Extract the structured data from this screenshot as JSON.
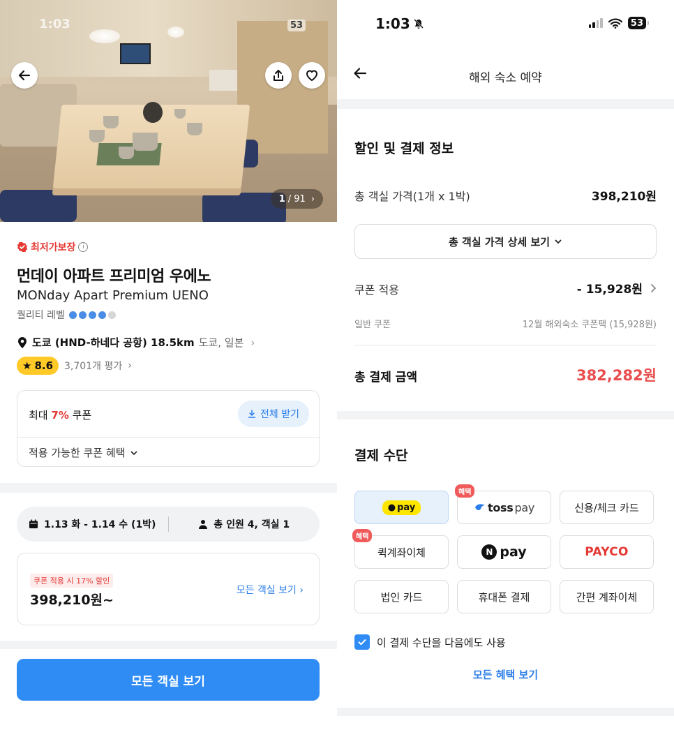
{
  "left": {
    "status_time": "1:03",
    "battery": "53",
    "photo_counter": {
      "current": "1",
      "total": "/ 91"
    },
    "lowest_price_badge": "최저가보장",
    "hotel_name_ko": "먼데이 아파트 프리미엄 우에노",
    "hotel_name_en": "MONday Apart Premium UENO",
    "quality_label": "퀄리티 레벨",
    "quality_level": 4,
    "quality_max": 5,
    "location_main": "도쿄 (HND-하네다 공항) 18.5km",
    "location_sub": "도쿄, 일본",
    "rating": "8.6",
    "review_count": "3,701개 평가",
    "coupon": {
      "prefix": "최대",
      "percent": "7%",
      "suffix": "쿠폰",
      "download_label": "전체 받기",
      "benefits_label": "적용 가능한 쿠폰 혜택"
    },
    "stay": {
      "dates": "1.13 화 - 1.14 수 (1박)",
      "guests": "총 인원 4, 객실 1"
    },
    "price_box": {
      "discount_tag": "쿠폰 적용 시 17% 할인",
      "price": "398,210원~",
      "all_rooms_link": "모든 객실 보기"
    },
    "cta_label": "모든 객실 보기"
  },
  "right": {
    "status_time": "1:03",
    "battery": "53",
    "nav_title": "해외 숙소 예약",
    "payment_info_title": "할인 및 결제 정보",
    "room_total_label": "총 객실 가격(1개 x 1박)",
    "room_total_value": "398,210원",
    "detail_button": "총 객실 가격 상세 보기",
    "coupon_label": "쿠폰 적용",
    "coupon_value": "- 15,928원",
    "general_coupon_label": "일반 쿠폰",
    "general_coupon_value": "12월 해외숙소 쿠폰팩 (15,928원)",
    "total_label": "총 결제 금액",
    "total_value": "382,282원",
    "payment_method_title": "결제 수단",
    "benefit_tag": "혜택",
    "methods": {
      "kakao": "pay",
      "toss_a": "toss",
      "toss_b": "pay",
      "card": "신용/체크 카드",
      "quick_transfer": "퀵계좌이체",
      "npay_n": "N",
      "npay": "pay",
      "payco": "PAYCO",
      "corporate_card": "법인 카드",
      "phone": "휴대폰 결제",
      "easy_transfer": "간편 계좌이체"
    },
    "reuse_label": "이 결제 수단을 다음에도 사용",
    "benefits_link": "모든 혜택 보기"
  },
  "colors": {
    "accent_blue": "#2f8cf5",
    "link_blue": "#2b7de9",
    "discount_red": "#e94e4e",
    "rating_yellow": "#ffc928",
    "kakao_yellow": "#fee500"
  }
}
